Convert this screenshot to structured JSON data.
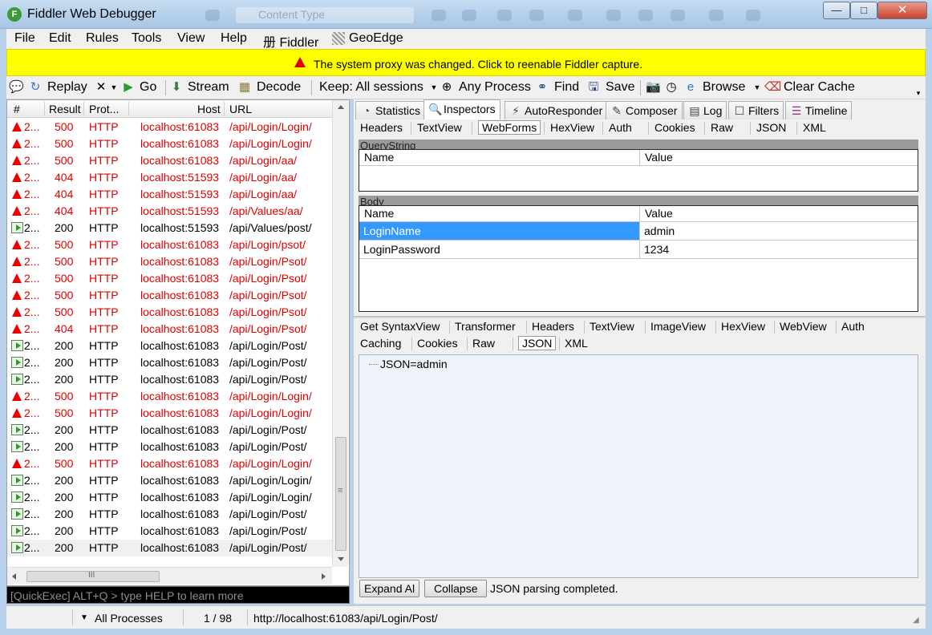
{
  "window": {
    "title": "Fiddler Web Debugger",
    "icon_glyph": "F",
    "ghost_search_placeholder": "Content Type",
    "min_glyph": "—",
    "max_glyph": "□",
    "close_glyph": "✕"
  },
  "menu": {
    "items": [
      "File",
      "Edit",
      "Rules",
      "Tools",
      "View",
      "Help",
      "册 Fiddler",
      "GeoEdge"
    ]
  },
  "banner": {
    "text": "The system proxy was changed. Click to reenable Fiddler capture."
  },
  "toolbar": {
    "replay": "Replay",
    "go": "Go",
    "stream": "Stream",
    "decode": "Decode",
    "keep": "Keep: All sessions",
    "any_process": "Any Process",
    "find": "Find",
    "save": "Save",
    "browse": "Browse",
    "clear_cache": "Clear Cache"
  },
  "sessions": {
    "headers": {
      "num": "#",
      "result": "Result",
      "protocol": "Prot...",
      "host": "Host",
      "url": "URL"
    },
    "rows": [
      {
        "num": "2...",
        "result": "500",
        "protocol": "HTTP",
        "host": "localhost:61083",
        "url": "/api/Login/Login/",
        "status": "error"
      },
      {
        "num": "2...",
        "result": "500",
        "protocol": "HTTP",
        "host": "localhost:61083",
        "url": "/api/Login/Login/",
        "status": "error"
      },
      {
        "num": "2...",
        "result": "500",
        "protocol": "HTTP",
        "host": "localhost:61083",
        "url": "/api/Login/aa/",
        "status": "error"
      },
      {
        "num": "2...",
        "result": "404",
        "protocol": "HTTP",
        "host": "localhost:51593",
        "url": "/api/Login/aa/",
        "status": "error"
      },
      {
        "num": "2...",
        "result": "404",
        "protocol": "HTTP",
        "host": "localhost:51593",
        "url": "/api/Login/aa/",
        "status": "error"
      },
      {
        "num": "2...",
        "result": "404",
        "protocol": "HTTP",
        "host": "localhost:51593",
        "url": "/api/Values/aa/",
        "status": "error"
      },
      {
        "num": "2...",
        "result": "200",
        "protocol": "HTTP",
        "host": "localhost:51593",
        "url": "/api/Values/post/",
        "status": "ok"
      },
      {
        "num": "2...",
        "result": "500",
        "protocol": "HTTP",
        "host": "localhost:61083",
        "url": "/api/Login/psot/",
        "status": "error"
      },
      {
        "num": "2...",
        "result": "500",
        "protocol": "HTTP",
        "host": "localhost:61083",
        "url": "/api/Login/Psot/",
        "status": "error"
      },
      {
        "num": "2...",
        "result": "500",
        "protocol": "HTTP",
        "host": "localhost:61083",
        "url": "/api/Login/Psot/",
        "status": "error"
      },
      {
        "num": "2...",
        "result": "500",
        "protocol": "HTTP",
        "host": "localhost:61083",
        "url": "/api/Login/Psot/",
        "status": "error"
      },
      {
        "num": "2...",
        "result": "500",
        "protocol": "HTTP",
        "host": "localhost:61083",
        "url": "/api/Login/Psot/",
        "status": "error"
      },
      {
        "num": "2...",
        "result": "404",
        "protocol": "HTTP",
        "host": "localhost:61083",
        "url": "/api/Login/Psot/",
        "status": "error"
      },
      {
        "num": "2...",
        "result": "200",
        "protocol": "HTTP",
        "host": "localhost:61083",
        "url": "/api/Login/Post/",
        "status": "ok"
      },
      {
        "num": "2...",
        "result": "200",
        "protocol": "HTTP",
        "host": "localhost:61083",
        "url": "/api/Login/Post/",
        "status": "ok"
      },
      {
        "num": "2...",
        "result": "200",
        "protocol": "HTTP",
        "host": "localhost:61083",
        "url": "/api/Login/Post/",
        "status": "ok"
      },
      {
        "num": "2...",
        "result": "500",
        "protocol": "HTTP",
        "host": "localhost:61083",
        "url": "/api/Login/Login/",
        "status": "error"
      },
      {
        "num": "2...",
        "result": "500",
        "protocol": "HTTP",
        "host": "localhost:61083",
        "url": "/api/Login/Login/",
        "status": "error"
      },
      {
        "num": "2...",
        "result": "200",
        "protocol": "HTTP",
        "host": "localhost:61083",
        "url": "/api/Login/Post/",
        "status": "ok"
      },
      {
        "num": "2...",
        "result": "200",
        "protocol": "HTTP",
        "host": "localhost:61083",
        "url": "/api/Login/Post/",
        "status": "ok"
      },
      {
        "num": "2...",
        "result": "500",
        "protocol": "HTTP",
        "host": "localhost:61083",
        "url": "/api/Login/Login/",
        "status": "error"
      },
      {
        "num": "2...",
        "result": "200",
        "protocol": "HTTP",
        "host": "localhost:61083",
        "url": "/api/Login/Login/",
        "status": "ok"
      },
      {
        "num": "2...",
        "result": "200",
        "protocol": "HTTP",
        "host": "localhost:61083",
        "url": "/api/Login/Login/",
        "status": "ok"
      },
      {
        "num": "2...",
        "result": "200",
        "protocol": "HTTP",
        "host": "localhost:61083",
        "url": "/api/Login/Post/",
        "status": "ok"
      },
      {
        "num": "2...",
        "result": "200",
        "protocol": "HTTP",
        "host": "localhost:61083",
        "url": "/api/Login/Post/",
        "status": "ok"
      },
      {
        "num": "2...",
        "result": "200",
        "protocol": "HTTP",
        "host": "localhost:61083",
        "url": "/api/Login/Post/",
        "status": "ok"
      }
    ],
    "hscroll_grip": "III",
    "vscroll_grip": "≡",
    "colors": {
      "error": "#e00000",
      "ok": "#000000"
    }
  },
  "quickexec": {
    "placeholder": "[QuickExec] ALT+Q > type HELP to learn more"
  },
  "tabs": {
    "statistics": "Statistics",
    "inspectors": "Inspectors",
    "autoresponder": "AutoResponder",
    "composer": "Composer",
    "log": "Log",
    "filters": "Filters",
    "timeline": "Timeline"
  },
  "request_tabs": [
    "Headers",
    "TextView",
    "WebForms",
    "HexView",
    "Auth",
    "Cookies",
    "Raw",
    "JSON",
    "XML"
  ],
  "request_active": "WebForms",
  "querystring": {
    "title": "QueryString",
    "col_name": "Name",
    "col_value": "Value"
  },
  "body": {
    "title": "Body",
    "col_name": "Name",
    "col_value": "Value",
    "rows": [
      {
        "name": "LoginName",
        "value": "admin"
      },
      {
        "name": "LoginPassword",
        "value": "1234"
      }
    ]
  },
  "response_tabs_row1": [
    "Get SyntaxView",
    "Transformer",
    "Headers",
    "TextView",
    "ImageView",
    "HexView",
    "WebView",
    "Auth"
  ],
  "response_tabs_row2": [
    "Caching",
    "Cookies",
    "Raw",
    "JSON",
    "XML"
  ],
  "response_active": "JSON",
  "json_tree": {
    "node": "JSON=admin"
  },
  "json_actions": {
    "expand": "Expand Al",
    "collapse": "Collapse",
    "status": "JSON parsing completed."
  },
  "statusbar": {
    "processes": "All Processes",
    "count": "1 / 98",
    "url": "http://localhost:61083/api/Login/Post/"
  }
}
